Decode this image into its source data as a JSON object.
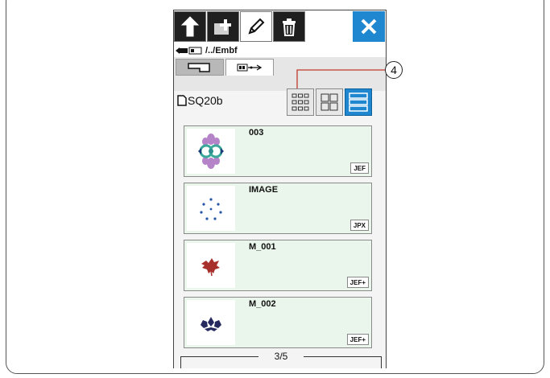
{
  "toolbar": {
    "buttons": [
      {
        "icon": "back-arrow-icon"
      },
      {
        "icon": "new-folder-icon"
      },
      {
        "icon": "pencil-icon"
      },
      {
        "icon": "trash-icon"
      }
    ],
    "close_icon": "close-icon",
    "accent_color": "#1e87d0"
  },
  "path": {
    "text": "/../Embf"
  },
  "tabs": [
    {
      "icon": "machine-memory-icon",
      "selected": false
    },
    {
      "icon": "usb-icon",
      "selected": true
    }
  ],
  "header": {
    "label": "SQ20b",
    "callout": "4"
  },
  "view_options": [
    {
      "icon": "small-grid-icon",
      "selected": false
    },
    {
      "icon": "large-grid-icon",
      "selected": false
    },
    {
      "icon": "list-view-icon",
      "selected": true
    }
  ],
  "files": [
    {
      "name": "003",
      "format": "JEF"
    },
    {
      "name": "IMAGE",
      "format": "JPX"
    },
    {
      "name": "M_001",
      "format": "JEF+"
    },
    {
      "name": "M_002",
      "format": "JEF+"
    }
  ],
  "pagination": {
    "text": "3/5"
  }
}
